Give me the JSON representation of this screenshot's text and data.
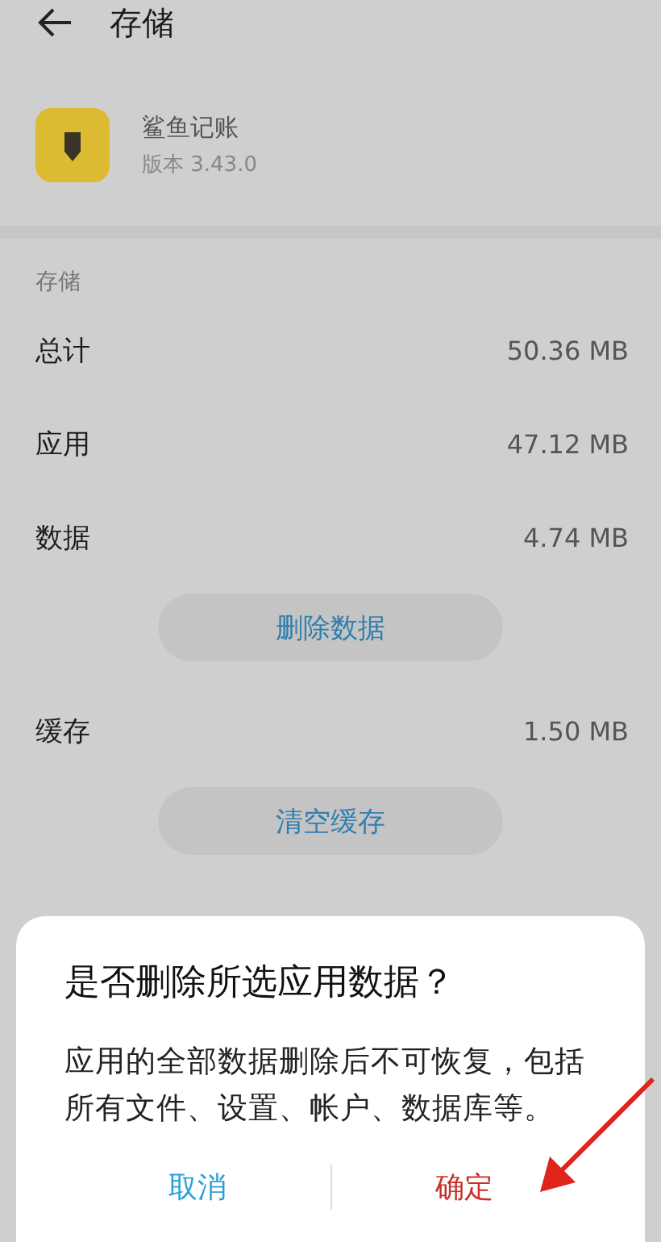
{
  "header": {
    "title": "存储"
  },
  "app": {
    "name": "鲨鱼记账",
    "version": "版本 3.43.0"
  },
  "section_label": "存储",
  "rows": [
    {
      "label": "总计",
      "value": "50.36 MB"
    },
    {
      "label": "应用",
      "value": "47.12 MB"
    },
    {
      "label": "数据",
      "value": "4.74 MB",
      "action": "删除数据"
    },
    {
      "label": "缓存",
      "value": "1.50 MB",
      "action": "清空缓存"
    }
  ],
  "dialog": {
    "title": "是否删除所选应用数据？",
    "message": "应用的全部数据删除后不可恢复，包括所有文件、设置、帐户、数据库等。",
    "buttons": [
      {
        "label": "取消",
        "kind": "cancel"
      },
      {
        "label": "确定",
        "kind": "confirm"
      }
    ]
  }
}
